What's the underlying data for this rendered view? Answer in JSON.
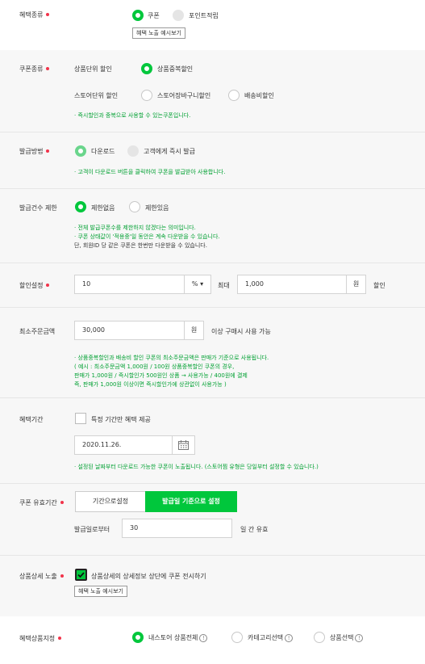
{
  "benefit_type": {
    "label": "혜택종류",
    "options": [
      "쿠폰",
      "포인트적립"
    ],
    "selected": "쿠폰",
    "preview_button": "혜택 노출 예시보기"
  },
  "coupon_type": {
    "label": "쿠폰종류",
    "product_group": "상품단위 할인",
    "product_option": "상품중복할인",
    "store_group": "스토어단위 할인",
    "store_options": [
      "스토어장바구니할인",
      "배송비할인"
    ],
    "note": "· 즉시할인과 중복으로 사용할 수 있는쿠폰입니다."
  },
  "issue_method": {
    "label": "발급방법",
    "options": [
      "다운로드",
      "고객에게 즉시 발급"
    ],
    "selected": "다운로드",
    "note": "· 고객이 다운로드 버튼을 클릭하여 쿠폰을 발급받아 사용합니다."
  },
  "issue_limit": {
    "label": "발급건수 제한",
    "options": [
      "제한없음",
      "제한있음"
    ],
    "selected": "제한없음",
    "notes": [
      "· 전체 발급쿠폰수를 제한하지 않겠다는 의미입니다.",
      "· 쿠폰 상태값이 '적용중'일 동안은 계속 다운받을 수 있습니다.",
      "단, 회원ID 당 같은 쿠폰은 한번만 다운받을 수 있습니다."
    ]
  },
  "discount": {
    "label": "할인설정",
    "value": "10",
    "unit": "%",
    "unit_caret": "▾",
    "max_label": "최대",
    "max_value": "1,000",
    "max_unit": "원",
    "suffix": "할인"
  },
  "min_order": {
    "label": "최소주문금액",
    "value": "30,000",
    "unit": "원",
    "suffix": "이상 구매시 사용 가능",
    "notes": [
      "· 상품중복할인과 배송비 할인 쿠폰의 최소주문금액은 판매가 기준으로 사용됩니다.",
      "( 예시 : 최소주문금액 1,000원 / 100원 상품중복할인 쿠폰의 경우,",
      "판매가 1,000원 / 즉시할인가 500원인 상품 → 사용가능 / 400원에 결제",
      "즉, 판매가 1,000원 이상이면 즉시할인가에 상관없이 사용가능 )"
    ]
  },
  "benefit_period": {
    "label": "혜택기간",
    "checkbox_label": "특정 기간만 혜택 제공",
    "date": "2020.11.26.",
    "note": "· 설정된 날짜부터 다운로드 가능한 쿠폰이 노출됩니다. (스토어찜 유형은 당일부터 설정할 수 있습니다.)"
  },
  "validity": {
    "label": "쿠폰 유효기간",
    "tabs": [
      "기간으로설정",
      "발급일 기준으로 설정"
    ],
    "active_tab": "발급일 기준으로 설정",
    "from_label": "발급일로부터",
    "days_value": "30",
    "days_suffix": "일 간 유효"
  },
  "product_detail": {
    "label": "상품상세 노출",
    "checkbox_label": "상품상세의 상세정보 상단에 쿠폰 전시하기",
    "checked": true,
    "preview_button": "혜택 노출 예시보기"
  },
  "target": {
    "label": "혜택상품지정",
    "options": [
      "내스토어 상품전체",
      "카테고리선택",
      "상품선택"
    ],
    "selected": "내스토어 상품전체",
    "info_glyph": "!"
  },
  "colors": {
    "accent": "#00c73c",
    "required_dot": "#f1334a",
    "note_text": "#00a032",
    "section_bg": "#f7f7f7"
  },
  "icons": [
    "required-dot",
    "radio",
    "calendar-icon",
    "checkbox",
    "info-icon",
    "caret-down-icon"
  ]
}
